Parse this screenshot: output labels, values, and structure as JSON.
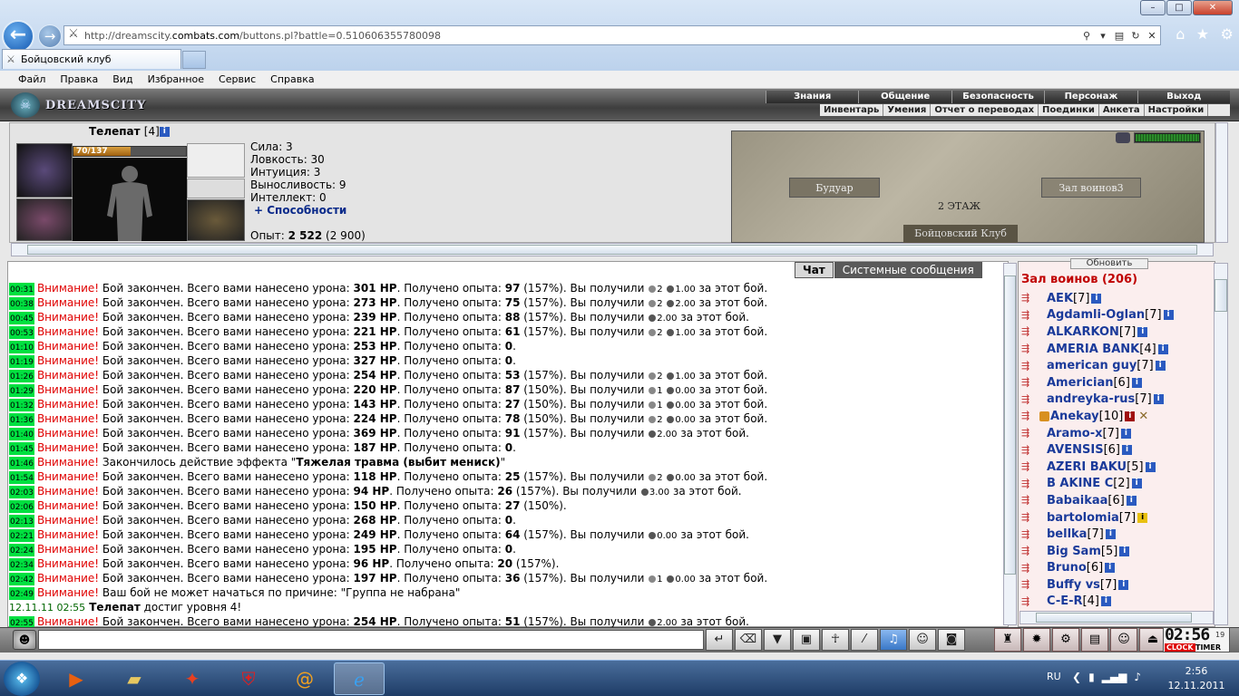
{
  "browser": {
    "url_prefix": "http://dreamscity.",
    "url_domain": "combats.com",
    "url_path": "/buttons.pl?battle=0.510606355780098",
    "tab_title": "Бойцовский клуб",
    "menu": [
      "Файл",
      "Правка",
      "Вид",
      "Избранное",
      "Сервис",
      "Справка"
    ]
  },
  "game": {
    "logo": "DREAMSCITY",
    "nav_main": [
      "Знания",
      "Общение",
      "Безопасность",
      "Персонаж",
      "Выход"
    ],
    "nav_sub": [
      "Инвентарь",
      "Умения",
      "Отчет о переводах",
      "Поединки",
      "Анкета",
      "Настройки"
    ]
  },
  "character": {
    "name": "Телепат",
    "level": "[4]",
    "hp_text": "70/137",
    "hp_fraction": 0.51,
    "stats": [
      "Сила: 3",
      "Ловкость: 30",
      "Интуиция: 3",
      "Выносливость: 9",
      "Интеллект: 0"
    ],
    "abilities_label": "+ Способности",
    "exp_label": "Опыт:",
    "exp_value": "2 522",
    "exp_next": "(2 900)"
  },
  "map": {
    "room_left": "Будуар",
    "room_right": "Зал воинов3",
    "floor": "2 ЭТАЖ",
    "club": "Бойцовский Клуб"
  },
  "chat": {
    "tab_chat": "Чат",
    "tab_system": "Системные сообщения",
    "warn": "Внимание!",
    "lines": [
      {
        "t": "00:31",
        "type": "win",
        "dmg": "301 HP",
        "exp": "97",
        "pct": "(157%)",
        "c1": "2",
        "c2": "1.00"
      },
      {
        "t": "00:38",
        "type": "win",
        "dmg": "273 HP",
        "exp": "75",
        "pct": "(157%)",
        "c1": "2",
        "c2": "2.00"
      },
      {
        "t": "00:45",
        "type": "win",
        "dmg": "239 HP",
        "exp": "88",
        "pct": "(157%)",
        "c1": "",
        "c2": "2.00"
      },
      {
        "t": "00:53",
        "type": "win",
        "dmg": "221 HP",
        "exp": "61",
        "pct": "(157%)",
        "c1": "2",
        "c2": "1.00"
      },
      {
        "t": "01:10",
        "type": "lose",
        "dmg": "253 HP",
        "exp": "0"
      },
      {
        "t": "01:19",
        "type": "lose",
        "dmg": "327 HP",
        "exp": "0"
      },
      {
        "t": "01:26",
        "type": "win",
        "dmg": "254 HP",
        "exp": "53",
        "pct": "(157%)",
        "c1": "2",
        "c2": "1.00"
      },
      {
        "t": "01:29",
        "type": "win",
        "dmg": "220 HP",
        "exp": "87",
        "pct": "(150%)",
        "c1": "1",
        "c2": "0.00"
      },
      {
        "t": "01:32",
        "type": "win",
        "dmg": "143 HP",
        "exp": "27",
        "pct": "(150%)",
        "c1": "1",
        "c2": "0.00"
      },
      {
        "t": "01:36",
        "type": "win",
        "dmg": "224 HP",
        "exp": "78",
        "pct": "(150%)",
        "c1": "2",
        "c2": "0.00"
      },
      {
        "t": "01:40",
        "type": "win",
        "dmg": "369 HP",
        "exp": "91",
        "pct": "(157%)",
        "c1": "",
        "c2": "2.00"
      },
      {
        "t": "01:45",
        "type": "lose",
        "dmg": "187 HP",
        "exp": "0"
      },
      {
        "t": "01:46",
        "type": "effect",
        "text": "Закончилось действие эффекта \"",
        "bold": "Тяжелая травма (выбит мениск)",
        "end": "\""
      },
      {
        "t": "01:54",
        "type": "win",
        "dmg": "118 HP",
        "exp": "25",
        "pct": "(157%)",
        "c1": "2",
        "c2": "0.00"
      },
      {
        "t": "02:03",
        "type": "win2",
        "dmg": "94 HP",
        "exp": "26",
        "pct": "(157%)",
        "c1": "",
        "c2": "3.00"
      },
      {
        "t": "02:06",
        "type": "pct",
        "dmg": "150 HP",
        "exp": "27",
        "pct": "(150%)"
      },
      {
        "t": "02:13",
        "type": "lose",
        "dmg": "268 HP",
        "exp": "0"
      },
      {
        "t": "02:21",
        "type": "win",
        "dmg": "249 HP",
        "exp": "64",
        "pct": "(157%)",
        "c1": "",
        "c2": "0.00"
      },
      {
        "t": "02:24",
        "type": "lose",
        "dmg": "195 HP",
        "exp": "0"
      },
      {
        "t": "02:34",
        "type": "pct2",
        "dmg": "96 HP",
        "exp": "20",
        "pct": "(157%)"
      },
      {
        "t": "02:42",
        "type": "win",
        "dmg": "197 HP",
        "exp": "36",
        "pct": "(157%)",
        "c1": "1",
        "c2": "0.00"
      },
      {
        "t": "02:49",
        "type": "fail",
        "text": "Ваш бой не может начаться по причине: \"Группа не набрана\""
      },
      {
        "t": "12.11.11 02:55",
        "type": "lvl",
        "name": "Телепат",
        "text": " достиг уровня 4!"
      },
      {
        "t": "02:55",
        "type": "win",
        "dmg": "254 HP",
        "exp": "51",
        "pct": "(157%)",
        "c1": "",
        "c2": "2.00"
      }
    ],
    "phr": {
      "end": "Бой закончен. Всего вами нанесено урона:",
      "got": ". Получено опыта:",
      "got2": ". Получено опыта:",
      "recv": ". Вы получили",
      "tail": "за этот бой."
    }
  },
  "users": {
    "refresh": "Обновить",
    "room": "Зал воинов (206)",
    "list": [
      {
        "n": "AEK",
        "l": "[7]"
      },
      {
        "n": "Agdamli-Oglan",
        "l": "[7]"
      },
      {
        "n": "ALKARKON",
        "l": "[7]"
      },
      {
        "n": "AMERIA BANK",
        "l": "[4]"
      },
      {
        "n": "american guy",
        "l": "[7]"
      },
      {
        "n": "Americian",
        "l": "[6]"
      },
      {
        "n": "andreyka-rus",
        "l": "[7]"
      },
      {
        "n": "Anekay",
        "l": "[10]",
        "clan": true,
        "red": true,
        "cross": true
      },
      {
        "n": "Aramo-x",
        "l": "[7]"
      },
      {
        "n": "AVENSIS",
        "l": "[6]"
      },
      {
        "n": "AZERI BAKU",
        "l": "[5]"
      },
      {
        "n": "B AKINE C",
        "l": "[2]"
      },
      {
        "n": "Babaikaa",
        "l": "[6]"
      },
      {
        "n": "bartolomia",
        "l": "[7]",
        "yellow": true
      },
      {
        "n": "bellka",
        "l": "[7]"
      },
      {
        "n": "Big Sam",
        "l": "[5]"
      },
      {
        "n": "Bruno",
        "l": "[6]"
      },
      {
        "n": "Buffy vs",
        "l": "[7]"
      },
      {
        "n": "C-E-R",
        "l": "[4]"
      }
    ]
  },
  "clock": {
    "time": "02:56",
    "sec": "19",
    "clock_lbl": "CLOCK",
    "timer_lbl": "TIMER"
  },
  "taskbar": {
    "lang": "RU",
    "time": "2:56",
    "date": "12.11.2011"
  }
}
